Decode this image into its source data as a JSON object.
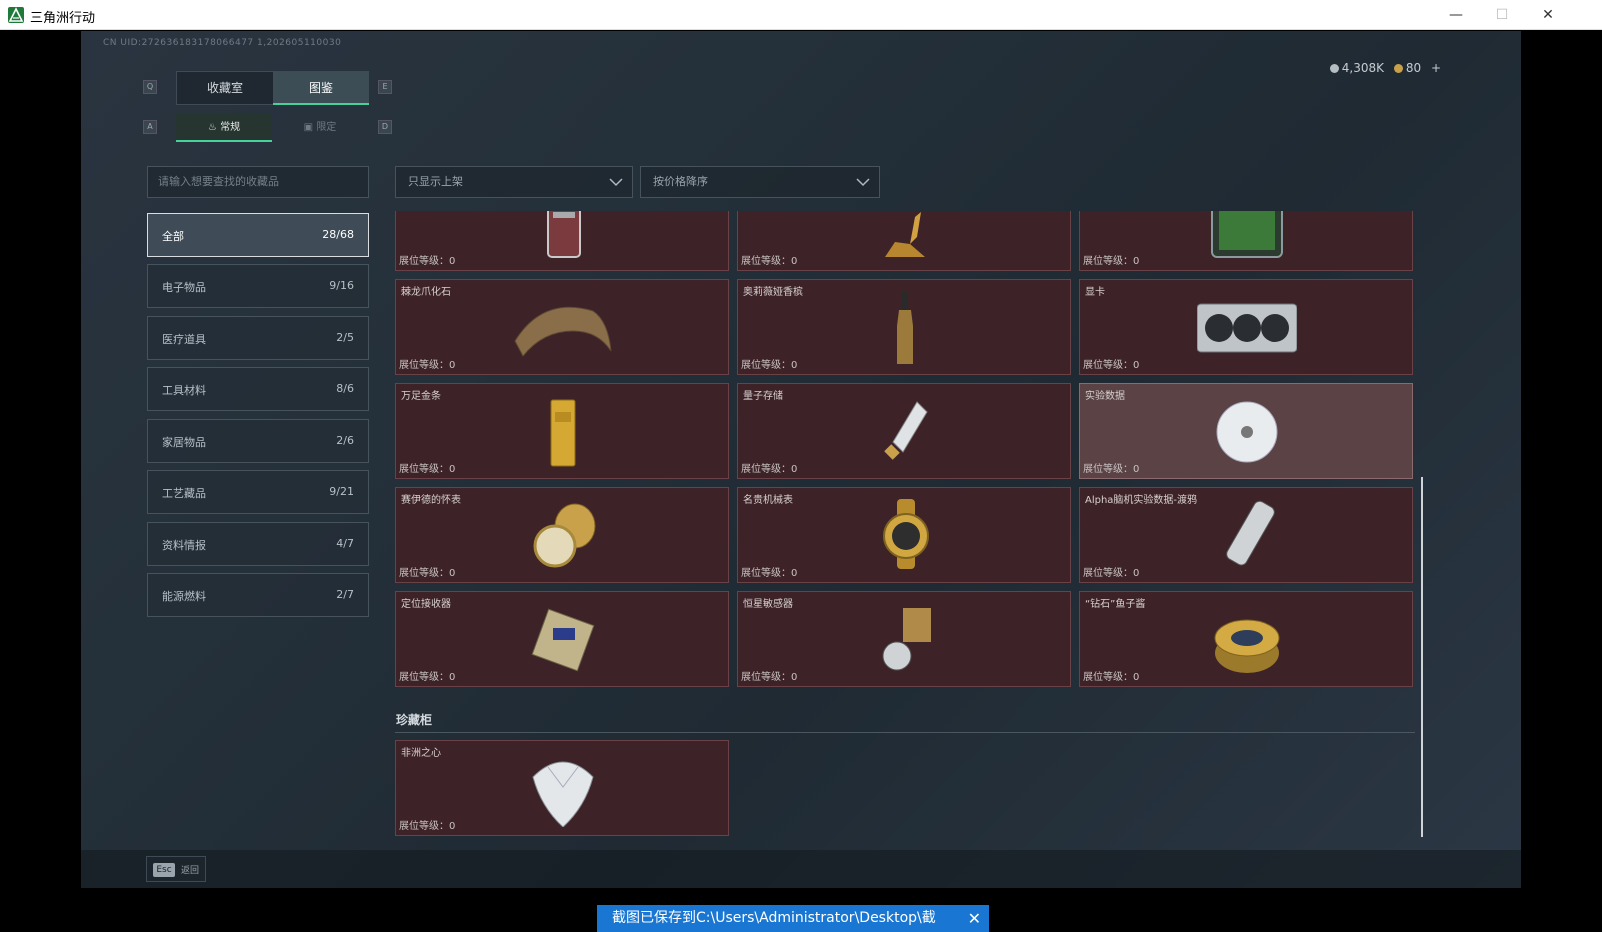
{
  "window": {
    "title": "三角洲行动",
    "minimize": "—",
    "maximize": "☐",
    "close": "✕"
  },
  "uid": "CN UID:272636183178066477 1,202605110030",
  "keys": {
    "q": "Q",
    "e": "E",
    "a": "A",
    "d": "D"
  },
  "tabs": {
    "collection": "收藏室",
    "catalog": "图鉴",
    "normal": "常规",
    "limited": "限定"
  },
  "currency": {
    "silver": "4,308K",
    "gold": "80",
    "plus": "+"
  },
  "search": {
    "placeholder": "请输入想要查找的收藏品"
  },
  "filters": {
    "shelf": "只显示上架",
    "sort": "按价格降序"
  },
  "categories": [
    {
      "name": "全部",
      "count": "28/68"
    },
    {
      "name": "电子物品",
      "count": "9/16"
    },
    {
      "name": "医疗道具",
      "count": "2/5"
    },
    {
      "name": "工具材料",
      "count": "8/6"
    },
    {
      "name": "家居物品",
      "count": "2/6"
    },
    {
      "name": "工艺藏品",
      "count": "9/21"
    },
    {
      "name": "资料情报",
      "count": "4/7"
    },
    {
      "name": "能源燃料",
      "count": "2/7"
    }
  ],
  "level_label": "展位等级：",
  "items": [
    {
      "name": "",
      "level": "0",
      "icon": "charger-icon"
    },
    {
      "name": "",
      "level": "0",
      "icon": "golden-deer-icon"
    },
    {
      "name": "",
      "level": "0",
      "icon": "circuit-case-icon"
    },
    {
      "name": "棘龙爪化石",
      "level": "0",
      "icon": "claw-fossil-icon"
    },
    {
      "name": "奥莉薇娅香槟",
      "level": "0",
      "icon": "champagne-icon"
    },
    {
      "name": "显卡",
      "level": "0",
      "icon": "graphics-card-icon"
    },
    {
      "name": "万足金条",
      "level": "0",
      "icon": "gold-bar-icon"
    },
    {
      "name": "量子存储",
      "level": "0",
      "icon": "usb-drive-icon"
    },
    {
      "name": "实验数据",
      "level": "0",
      "icon": "disc-icon"
    },
    {
      "name": "赛伊德的怀表",
      "level": "0",
      "icon": "pocket-watch-icon"
    },
    {
      "name": "名贵机械表",
      "level": "0",
      "icon": "wristwatch-icon"
    },
    {
      "name": "Alpha脑机实验数据-渡鸦",
      "level": "0",
      "icon": "data-cylinder-icon"
    },
    {
      "name": "定位接收器",
      "level": "0",
      "icon": "receiver-icon"
    },
    {
      "name": "恒星敏感器",
      "level": "0",
      "icon": "sensor-icon"
    },
    {
      "name": "“钻石”鱼子酱",
      "level": "0",
      "icon": "caviar-tin-icon"
    }
  ],
  "section": {
    "title": "珍藏柜"
  },
  "vault_items": [
    {
      "name": "非洲之心",
      "level": "0",
      "icon": "diamond-icon"
    }
  ],
  "footer": {
    "esc": "Esc",
    "back": "返回"
  },
  "toast": {
    "text": "截图已保存到C:\\Users\\Administrator\\Desktop\\截",
    "close": "✕"
  },
  "colors": {
    "accent": "#4ad19a",
    "card_bg": "#3d2328",
    "card_border": "#6b4148",
    "toast": "#1976d2"
  }
}
